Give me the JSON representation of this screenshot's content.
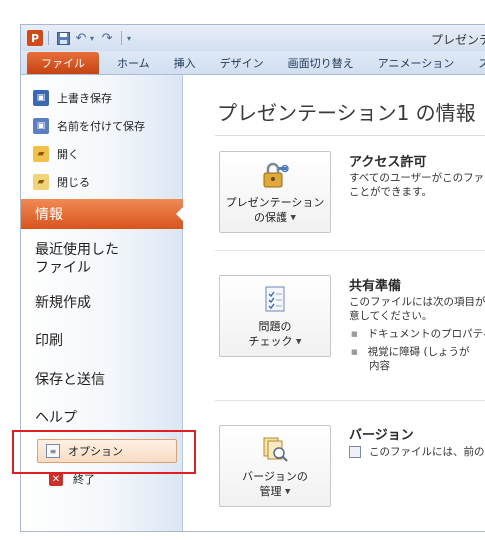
{
  "window": {
    "title": "プレゼンテー"
  },
  "qat": {
    "app_letter": "P",
    "save_icon": "floppy-icon",
    "undo_icon": "undo-icon",
    "redo_icon": "redo-icon"
  },
  "tabs": [
    {
      "label": "ファイル"
    },
    {
      "label": "ホーム"
    },
    {
      "label": "挿入"
    },
    {
      "label": "デザイン"
    },
    {
      "label": "画面切り替え"
    },
    {
      "label": "アニメーション"
    },
    {
      "label": "スライ"
    }
  ],
  "nav": {
    "commands": [
      {
        "label": "上書き保存"
      },
      {
        "label": "名前を付けて保存"
      },
      {
        "label": "開く"
      },
      {
        "label": "閉じる"
      }
    ],
    "tabs": [
      {
        "label": "情報"
      },
      {
        "label": "最近使用した"
      },
      {
        "label_line2": "ファイル"
      },
      {
        "label": "新規作成"
      },
      {
        "label": "印刷"
      },
      {
        "label": "保存と送信"
      },
      {
        "label": "ヘルプ"
      }
    ],
    "options": "オプション",
    "exit": "終了"
  },
  "info": {
    "title": "プレゼンテーション1 の情報",
    "sections": [
      {
        "button_line1": "プレゼンテーション",
        "button_line2": "の保護",
        "heading": "アクセス許可",
        "text1": "すべてのユーザーがこのファ",
        "text2": "ことができます。"
      },
      {
        "button_line1": "問題の",
        "button_line2": "チェック",
        "heading": "共有準備",
        "text1": "このファイルには次の項目が",
        "text2": "意してください。",
        "bullet1": "ドキュメントのプロパティ",
        "bullet2": "視覚に障碍 (しょうが",
        "bullet2_cont": "内容"
      },
      {
        "button_line1": "バージョンの",
        "button_line2": "管理",
        "heading": "バージョン",
        "text1": "このファイルには、前の"
      }
    ]
  },
  "colors": {
    "file_tab": "#d9531c",
    "highlight": "#e02020",
    "accent": "#f08a55"
  }
}
